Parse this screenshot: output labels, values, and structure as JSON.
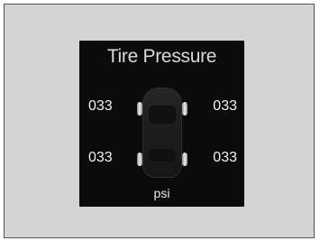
{
  "display": {
    "title": "Tire Pressure",
    "unit": "psi",
    "tires": {
      "front_left": "033",
      "front_right": "033",
      "rear_left": "033",
      "rear_right": "033"
    }
  },
  "icons": {
    "vehicle": "car-top-view-icon"
  },
  "colors": {
    "screen_background": "#0b0b0b",
    "panel_background": "#d4d4d4",
    "text": "#f2f2f2"
  }
}
